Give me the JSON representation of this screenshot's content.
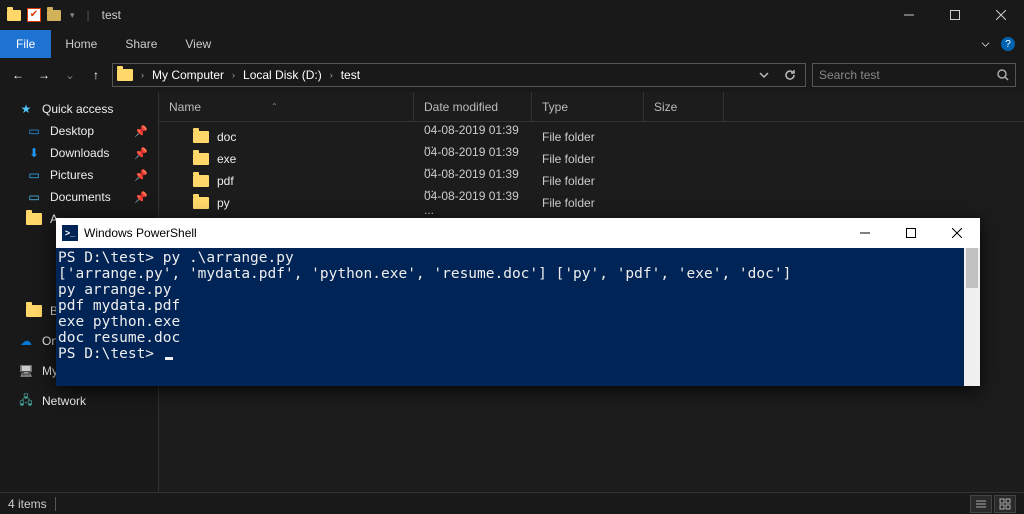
{
  "window": {
    "title": "test",
    "min": "–",
    "max": "☐",
    "close": "✕"
  },
  "menu": {
    "file": "File",
    "home": "Home",
    "share": "Share",
    "view": "View",
    "help": "?"
  },
  "nav": {
    "back": "←",
    "fwd": "→",
    "recent_caret": "⌄",
    "up": "↑",
    "crumb1": "My Computer",
    "crumb2": "Local Disk (D:)",
    "crumb3": "test",
    "search_placeholder": "Search test"
  },
  "sidebar": {
    "quick_access": "Quick access",
    "desktop": "Desktop",
    "downloads": "Downloads",
    "pictures": "Pictures",
    "documents": "Documents",
    "A": "A",
    "B": "B",
    "onedrive_short": "On",
    "my_short": "My",
    "network": "Network"
  },
  "cols": {
    "name": "Name",
    "date": "Date modified",
    "type": "Type",
    "size": "Size"
  },
  "rows": [
    {
      "name": "doc",
      "date": "04-08-2019 01:39 ...",
      "type": "File folder",
      "size": ""
    },
    {
      "name": "exe",
      "date": "04-08-2019 01:39 ...",
      "type": "File folder",
      "size": ""
    },
    {
      "name": "pdf",
      "date": "04-08-2019 01:39 ...",
      "type": "File folder",
      "size": ""
    },
    {
      "name": "py",
      "date": "04-08-2019 01:39 ...",
      "type": "File folder",
      "size": ""
    }
  ],
  "status": {
    "items": "4 items"
  },
  "ps": {
    "title": "Windows PowerShell",
    "lines": [
      "PS D:\\test> py .\\arrange.py",
      "['arrange.py', 'mydata.pdf', 'python.exe', 'resume.doc'] ['py', 'pdf', 'exe', 'doc']",
      "py arrange.py",
      "pdf mydata.pdf",
      "exe python.exe",
      "doc resume.doc",
      "PS D:\\test> "
    ]
  }
}
